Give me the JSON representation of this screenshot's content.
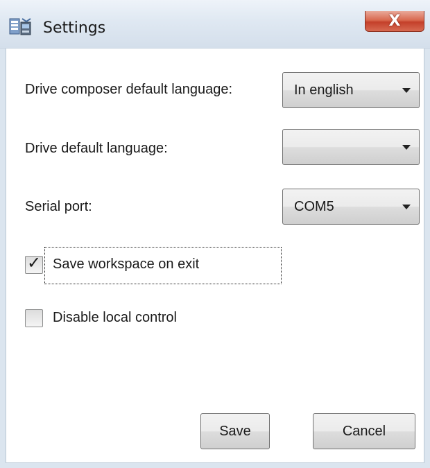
{
  "window": {
    "title": "Settings",
    "close_label": "X",
    "app_icon": "settings-app-icon"
  },
  "fields": {
    "composer_language": {
      "label": "Drive composer default language:",
      "value": "In english"
    },
    "drive_language": {
      "label": "Drive default language:",
      "value": ""
    },
    "serial_port": {
      "label": "Serial port:",
      "value": "COM5"
    }
  },
  "checkboxes": {
    "save_workspace": {
      "label": "Save workspace on exit",
      "checked": true
    },
    "disable_local_control": {
      "label": "Disable local control",
      "checked": false
    }
  },
  "buttons": {
    "save_label": "Save",
    "cancel_label": "Cancel"
  },
  "colors": {
    "close_button": "#c4402a",
    "titlebar": "#dfe8f2"
  }
}
